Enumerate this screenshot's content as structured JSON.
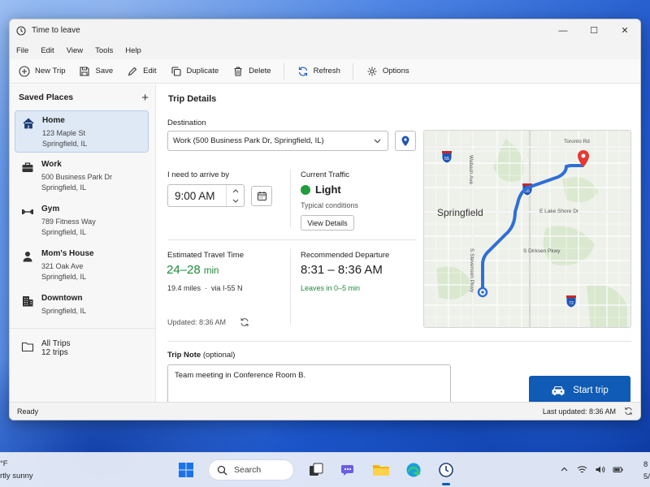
{
  "window": {
    "title": "Time to leave",
    "controls": {
      "minimize": "—",
      "maximize": "☐",
      "close": "✕"
    }
  },
  "menu": [
    "File",
    "Edit",
    "View",
    "Tools",
    "Help"
  ],
  "toolbar": {
    "new_trip": "New Trip",
    "save": "Save",
    "edit": "Edit",
    "duplicate": "Duplicate",
    "delete": "Delete",
    "refresh": "Refresh",
    "options": "Options"
  },
  "sidebar": {
    "title": "Saved Places",
    "add": "+",
    "places": [
      {
        "name": "Home",
        "line1": "123 Maple St",
        "line2": "Springfield, IL",
        "icon": "home-icon"
      },
      {
        "name": "Work",
        "line1": "500 Business Park Dr",
        "line2": "Springfield, IL",
        "icon": "briefcase-icon"
      },
      {
        "name": "Gym",
        "line1": "789 Fitness Way",
        "line2": "Springfield, IL",
        "icon": "dumbbell-icon"
      },
      {
        "name": "Mom's House",
        "line1": "321 Oak Ave",
        "line2": "Springfield, IL",
        "icon": "person-icon"
      },
      {
        "name": "Downtown",
        "line1": "Springfield, IL",
        "line2": "",
        "icon": "building-icon"
      }
    ],
    "all_trips": {
      "label": "All Trips",
      "count": "12 trips"
    }
  },
  "trip": {
    "section_title": "Trip Details",
    "destination_label": "Destination",
    "destination_value": "Work (500 Business Park Dr, Springfield, IL)",
    "arrive_label": "I need to arrive by",
    "arrive_time": "9:00 AM",
    "traffic_label": "Current Traffic",
    "traffic_level": "Light",
    "traffic_color": "#1f9d3c",
    "traffic_desc": "Typical conditions",
    "view_details": "View Details",
    "eta_label": "Estimated Travel Time",
    "eta_value": "24–28",
    "eta_unit": "min",
    "distance": "19.4 miles",
    "route": "via I-55 N",
    "updated": "Updated:  8:36 AM",
    "departure_label": "Recommended Departure",
    "departure_value": "8:31 – 8:36 AM",
    "departure_note": "Leaves in 0–5 min",
    "note_label": "Trip Note",
    "note_optional": "(optional)",
    "note_value": "Team meeting in Conference Room B.",
    "start_button": "Start trip"
  },
  "map": {
    "city": "Springfield",
    "labels": {
      "toronto": "Toronto Rd",
      "wabash": "Wabash Ave",
      "lake_shore": "E Lake Shore Dr",
      "dirksen": "S Dirksen Pkwy",
      "stevenson": "S Stevenson Pkwy"
    },
    "shields": {
      "i55_top": "55",
      "i55_mid": "55",
      "i72": "72"
    },
    "route_color": "#2f6fd6",
    "pin_color": "#e53935"
  },
  "status": {
    "left": "Ready",
    "last_updated": "Last updated:  8:36 AM"
  },
  "taskbar": {
    "weather_temp": "°F",
    "weather_desc": "rtly sunny",
    "search": "Search",
    "clock_time": "8",
    "clock_date": "5/2"
  }
}
